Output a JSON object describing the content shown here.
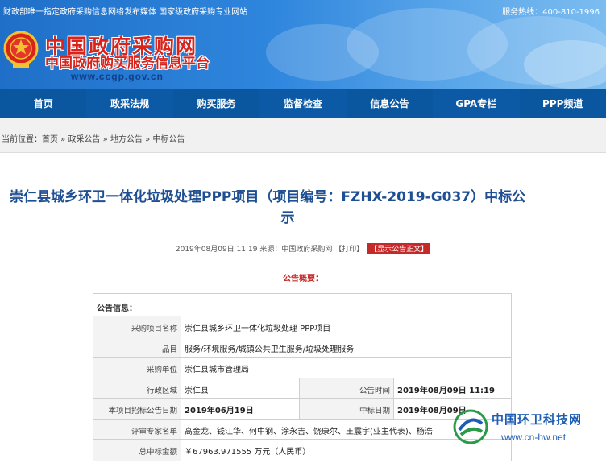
{
  "header": {
    "top_left": "财政部唯一指定政府采购信息网络发布媒体  国家级政府采购专业网站",
    "hotline": "服务热线：400-810-1996",
    "brand_line1": "中国政府采购网",
    "brand_line2": "中国政府购买服务信息平台",
    "brand_url": "www.ccgp.gov.cn",
    "emblem_icon": "national-emblem-icon",
    "colors": {
      "banner": "#2f86dd",
      "brand_red": "#d9241b",
      "nav": "#0c5aa6"
    }
  },
  "nav": {
    "items": [
      {
        "label": "首页"
      },
      {
        "label": "政采法规"
      },
      {
        "label": "购买服务"
      },
      {
        "label": "监督检查"
      },
      {
        "label": "信息公告"
      },
      {
        "label": "GPA专栏"
      },
      {
        "label": "PPP频道"
      }
    ]
  },
  "breadcrumb": {
    "prefix": "当前位置：",
    "items": [
      {
        "label": "首页"
      },
      {
        "label": "政采公告"
      },
      {
        "label": "地方公告"
      },
      {
        "label": "中标公告"
      }
    ],
    "separator": " » "
  },
  "article": {
    "title_line1": "崇仁县城乡环卫一体化垃圾处理PPP项目（项目编号：FZHX-2019-G037）中标公",
    "title_line2": "示",
    "meta_date": "2019年08月09日 11:19 来源：中国政府采购网",
    "print_label": "【打印】",
    "show_body_label": "【显示公告正文】",
    "summary_label": "公告概要："
  },
  "info_table": {
    "heading": "公告信息：",
    "rows": {
      "project_name": {
        "label": "采购项目名称",
        "value": "崇仁县城乡环卫一体化垃圾处理 PPP项目"
      },
      "category": {
        "label": "品目",
        "value": "服务/环境服务/城镇公共卫生服务/垃圾处理服务"
      },
      "purchaser": {
        "label": "采购单位",
        "value": "崇仁县城市管理局"
      },
      "region": {
        "label": "行政区域",
        "value": "崇仁县",
        "label2": "公告时间",
        "value2": "2019年08月09日 11:19"
      },
      "bid_date": {
        "label": "本项目招标公告日期",
        "value": "2019年06月19日",
        "label2": "中标日期",
        "value2": "2019年08月09日"
      },
      "experts": {
        "label": "评审专家名单",
        "value": "高金龙、钱江华、何中钢、涂永吉、饶康尔、王震宇(业主代表)、杨浩"
      },
      "amount": {
        "label": "总中标金额",
        "value": "￥67963.971555 万元（人民币）"
      }
    }
  },
  "watermark": {
    "name": "中国环卫科技网",
    "url": "www.cn-hw.net",
    "logo_icon": "cn-hw-logo-icon"
  }
}
